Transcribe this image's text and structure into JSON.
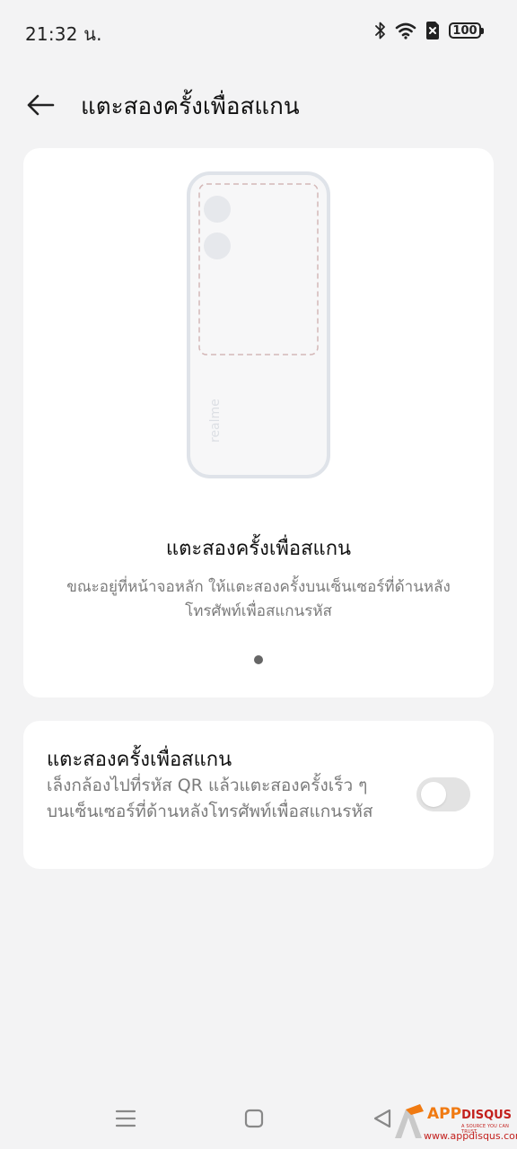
{
  "status_bar": {
    "time": "21:32 น.",
    "battery": "100",
    "icons": [
      "bluetooth-icon",
      "wifi-icon",
      "sim-blocked-icon",
      "battery-icon"
    ]
  },
  "header": {
    "title": "แตะสองครั้งเพื่อสแกน",
    "back_icon": "back-arrow-icon"
  },
  "intro": {
    "illustration_brand": "realme",
    "title": "แตะสองครั้งเพื่อสแกน",
    "description": "ขณะอยู่ที่หน้าจอหลัก ให้แตะสองครั้งบนเซ็นเซอร์ที่ด้านหลังโทรศัพท์เพื่อสแกนรหัส",
    "page_indicator": {
      "current": 1,
      "total": 1
    }
  },
  "setting": {
    "title": "แตะสองครั้งเพื่อสแกน",
    "description": "เล็งกล้องไปที่รหัส QR แล้วแตะสองครั้งเร็ว ๆ บนเซ็นเซอร์ที่ด้านหลังโทรศัพท์เพื่อสแกนรหัส",
    "enabled": false
  },
  "nav_bar": {
    "buttons": [
      "menu-icon",
      "home-icon",
      "back-icon"
    ]
  },
  "watermark": {
    "brand_app": "APP",
    "brand_disqus": "DISQUS",
    "tagline": "A SOURCE YOU CAN TRUST",
    "url": "www.appdisqus.com"
  },
  "colors": {
    "background": "#f3f3f4",
    "card": "#ffffff",
    "text_primary": "#111111",
    "text_secondary": "#7b7b7b",
    "toggle_off": "#e3e3e3",
    "illustration_outline": "#dfe3e9",
    "illustration_dash": "#d4b8b8"
  }
}
